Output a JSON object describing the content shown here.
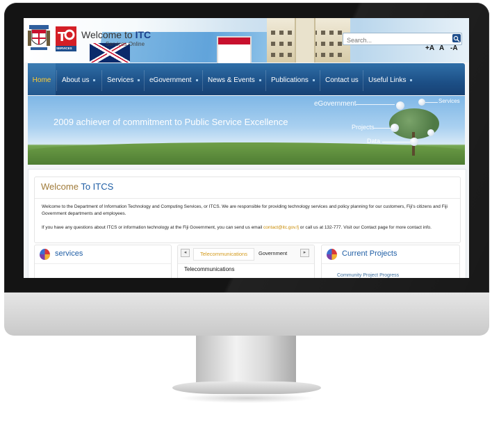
{
  "header": {
    "title_prefix": "Welcome to",
    "title_brand": "ITC",
    "subtitle": "Services Online",
    "logo_text": "SERVICES",
    "search_placeholder": "Search...",
    "font_controls": [
      "+A",
      "A",
      "-A"
    ]
  },
  "nav": {
    "items": [
      {
        "label": "Home",
        "active": true
      },
      {
        "label": "About us"
      },
      {
        "label": "Services"
      },
      {
        "label": "eGovernment"
      },
      {
        "label": "News & Events"
      },
      {
        "label": "Publications"
      },
      {
        "label": "Contact us"
      },
      {
        "label": "Useful Links"
      }
    ]
  },
  "banner": {
    "slogan": "2009 achiever of commitment to Public Service Excellence",
    "labels": {
      "egovernment": "eGovernment",
      "services": "Services",
      "projects": "Projects",
      "data": "Data"
    }
  },
  "welcome": {
    "title_prefix": "Welcome",
    "title_rest": "To ITCS",
    "para1": "Welcome to the Department of Information Technology and Computing Services, or ITCS. We are responsible for providing technology services and policy planning for our customers, Fiji's citizens and Fiji Government departments and employees.",
    "para2_before": "If you have any questions about ITCS or information technology at the Fiji Government, you can send us email ",
    "para2_email": "contact@itc.gov.fj",
    "para2_after": " or call us at 132-777. Visit our Contact page for more contact info."
  },
  "panels": {
    "services": {
      "title": "services"
    },
    "tabs": {
      "tab1": "Telecommunications",
      "tab2": "Government",
      "prev": "◂",
      "next": "▸",
      "content": "Telecommunications"
    },
    "projects": {
      "title": "Current Projects",
      "first_item": "Community Project Progress"
    }
  },
  "colors": {
    "nav_bg": "#1c4f86",
    "nav_active": "#ffcc33",
    "brand_blue": "#1f5ea5",
    "welcome_gold": "#a07b3a",
    "email": "#c88a00"
  }
}
